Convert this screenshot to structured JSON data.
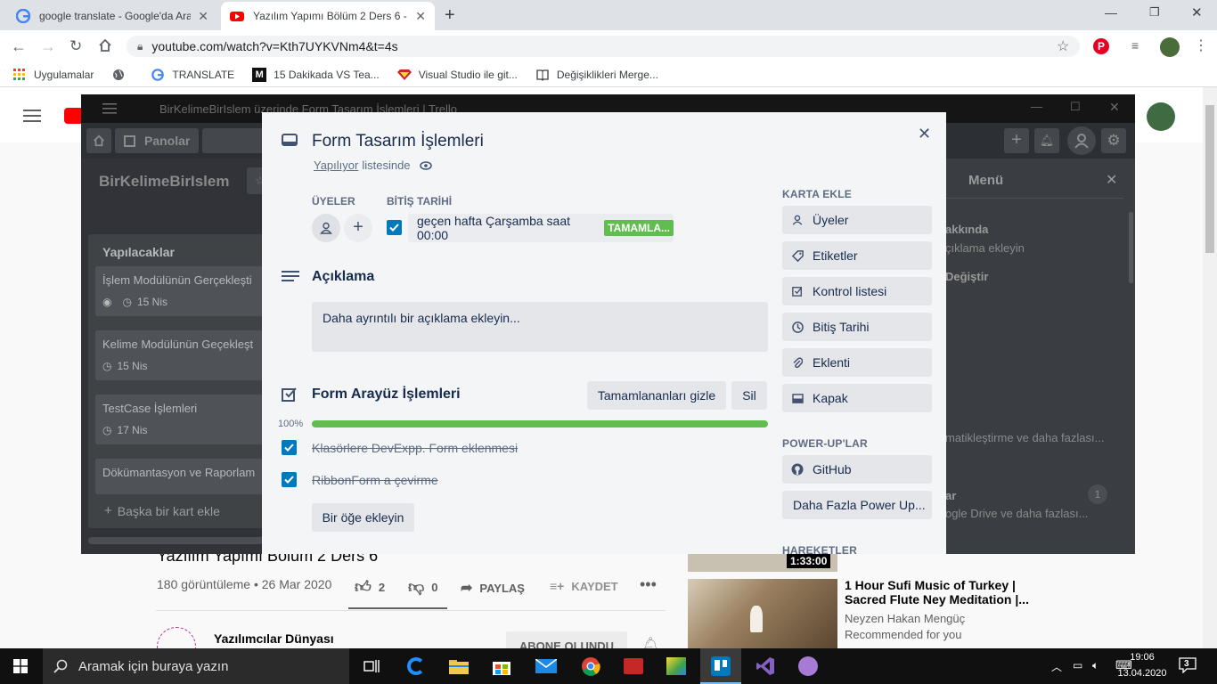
{
  "browser": {
    "tabs": [
      {
        "title": "google translate - Google'da Ara"
      },
      {
        "title": "Yazılım Yapımı Bölüm 2 Ders 6 - Y"
      }
    ],
    "url": "youtube.com/watch?v=Kth7UYKVNm4&t=4s",
    "bookmarks": [
      {
        "label": "Uygulamalar"
      },
      {
        "label": ""
      },
      {
        "label": "TRANSLATE"
      },
      {
        "label": "15 Dakikada VS Tea..."
      },
      {
        "label": "Visual Studio ile git..."
      },
      {
        "label": "Değişiklikleri Merge..."
      }
    ]
  },
  "trello_window": {
    "title": "BirKelimeBirIslem üzerinde Form Tasarım İşlemleri | Trello",
    "boards_label": "Panolar",
    "board_name": "BirKelimeBirIslem",
    "list": {
      "title": "Yapılacaklar",
      "cards": [
        {
          "title": "İşlem Modülünün Gerçekleşti",
          "date": "15 Nis",
          "watched": true
        },
        {
          "title": "Kelime Modülünün Geçekleşt",
          "date": "15 Nis",
          "watched": false
        },
        {
          "title": "TestCase İşlemleri",
          "date": "17 Nis",
          "watched": false
        },
        {
          "title": "Dökümantasyon ve Raporlam",
          "date": "",
          "watched": false
        }
      ],
      "add_card": "Başka bir kart ekle"
    },
    "menu": {
      "title": "Menü",
      "about_title": "akkında",
      "about_desc": "çıklama ekleyin",
      "change": "Değiştir",
      "automation": "matikleştirme ve daha fazlası...",
      "powerups_label": "ar",
      "powerups_desc": "ogle Drive ve daha fazlası...",
      "badge": "1"
    }
  },
  "card_modal": {
    "title": "Form Tasarım İşlemleri",
    "list_link": "Yapılıyor",
    "list_suffix": "listesinde",
    "members_label": "ÜYELER",
    "due_label": "BİTİŞ TARİHİ",
    "due_value": "geçen hafta Çarşamba saat 00:00",
    "due_badge": "TAMAMLA...",
    "description_title": "Açıklama",
    "description_placeholder": "Daha ayrıntılı bir açıklama ekleyin...",
    "checklist": {
      "title": "Form Arayüz İşlemleri",
      "hide_completed": "Tamamlananları gizle",
      "delete": "Sil",
      "progress_label": "100%",
      "progress": 1.0,
      "items": [
        {
          "text": "Klasörlere DevExpp. Form eklenmesi",
          "done": true
        },
        {
          "text": "RibbonForm a çevirme",
          "done": true
        }
      ],
      "add_item": "Bir öğe ekleyin"
    },
    "sidebar": {
      "add_to_card": "KARTA EKLE",
      "buttons": [
        {
          "label": "Üyeler",
          "icon": "person-icon"
        },
        {
          "label": "Etiketler",
          "icon": "label-icon"
        },
        {
          "label": "Kontrol listesi",
          "icon": "checklist-icon"
        },
        {
          "label": "Bitiş Tarihi",
          "icon": "clock-icon"
        },
        {
          "label": "Eklenti",
          "icon": "paperclip-icon"
        },
        {
          "label": "Kapak",
          "icon": "cover-icon"
        }
      ],
      "powerups": "POWER-UP'LAR",
      "github": "GitHub",
      "more_powerups": "Daha Fazla Power Up...",
      "activity": "HAREKETLER"
    }
  },
  "youtube": {
    "video_title": "Yazılım Yapımı Bölüm 2 Ders 6",
    "views": "180 görüntüleme • 26 Mar 2020",
    "likes": "2",
    "dislikes": "0",
    "share": "PAYLAŞ",
    "save": "KAYDET",
    "channel": "Yazılımcılar Dünyası",
    "subscribe": "ABONE OLUNDU",
    "rec_duration": "1:33:00",
    "rec2_title_1": "1 Hour Sufi Music of Turkey |",
    "rec2_title_2": "Sacred Flute Ney Meditation |...",
    "rec2_channel": "Neyzen Hakan Mengüç",
    "rec2_note": "Recommended for you"
  },
  "taskbar": {
    "search_placeholder": "Aramak için buraya yazın",
    "time": "19:06",
    "date": "13.04.2020",
    "notifications": "3"
  },
  "colors": {
    "trello_blue": "#0079bf",
    "progress_green": "#61bd4f",
    "due_green": "#61bd4f"
  }
}
